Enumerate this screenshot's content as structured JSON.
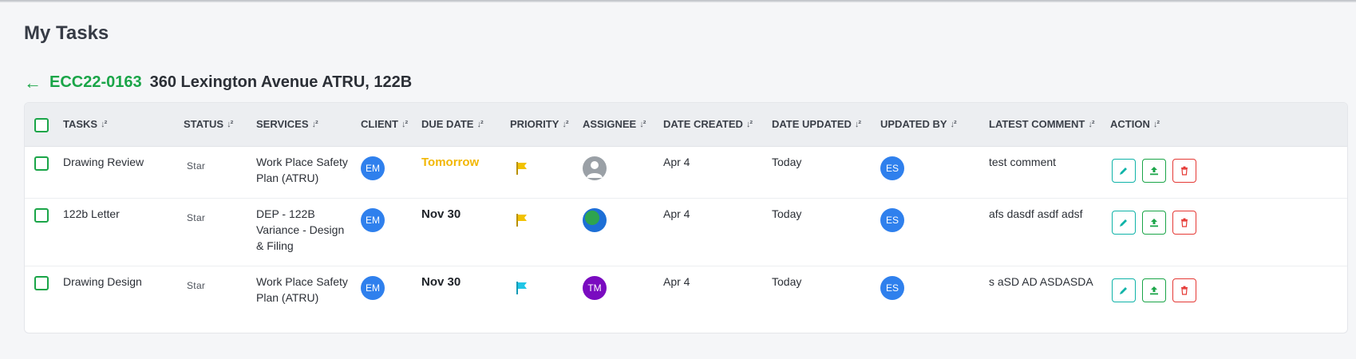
{
  "page": {
    "title": "My Tasks"
  },
  "project": {
    "back_icon": "←",
    "code": "ECC22-0163",
    "name": "360 Lexington Avenue ATRU, 122B"
  },
  "columns": {
    "tasks": "TASKS",
    "status": "STATUS",
    "services": "SERVICES",
    "client": "CLIENT",
    "due_date": "DUE DATE",
    "priority": "PRIORITY",
    "assignee": "ASSIGNEE",
    "date_created": "DATE CREATED",
    "date_updated": "DATE UPDATED",
    "updated_by": "UPDATED BY",
    "latest_comment": "LATEST COMMENT",
    "action": "ACTION",
    "sort_icon": "↓²"
  },
  "colors": {
    "accent_green": "#1aa548",
    "due_tomorrow": "#f2b705",
    "flag_yellow": "#f2c200",
    "flag_cyan": "#20c6e6",
    "avatar_blue": "#2f80ed",
    "avatar_purple": "#7a0bc0",
    "edit_teal": "#0fb3a8",
    "delete_red": "#e53935"
  },
  "rows": [
    {
      "task": "Drawing Review",
      "status": "Star",
      "services_lines": [
        "Work Place Safety",
        "Plan (ATRU)"
      ],
      "client_initials": "EM",
      "due_date": "Tomorrow",
      "priority_flag": "yellow-flag-icon",
      "assignee": "default-user-avatar",
      "date_created": "Apr 4",
      "date_updated": "Today",
      "updated_by_initials": "ES",
      "latest_comment": "test comment"
    },
    {
      "task": "122b Letter",
      "status": "Star",
      "services_lines": [
        "DEP - 122B",
        "Variance - Design",
        "& Filing"
      ],
      "client_initials": "EM",
      "due_date": "Nov 30",
      "priority_flag": "yellow-flag-icon",
      "assignee": "globe-avatar",
      "date_created": "Apr 4",
      "date_updated": "Today",
      "updated_by_initials": "ES",
      "latest_comment": "afs dasdf asdf adsf"
    },
    {
      "task": "Drawing Design",
      "status": "Star",
      "services_lines": [
        "Work Place Safety",
        "Plan (ATRU)"
      ],
      "client_initials": "EM",
      "due_date": "Nov 30",
      "priority_flag": "cyan-flag-icon",
      "assignee_initials": "TM",
      "date_created": "Apr 4",
      "date_updated": "Today",
      "updated_by_initials": "ES",
      "latest_comment": "s aSD AD ASDASDA"
    }
  ]
}
